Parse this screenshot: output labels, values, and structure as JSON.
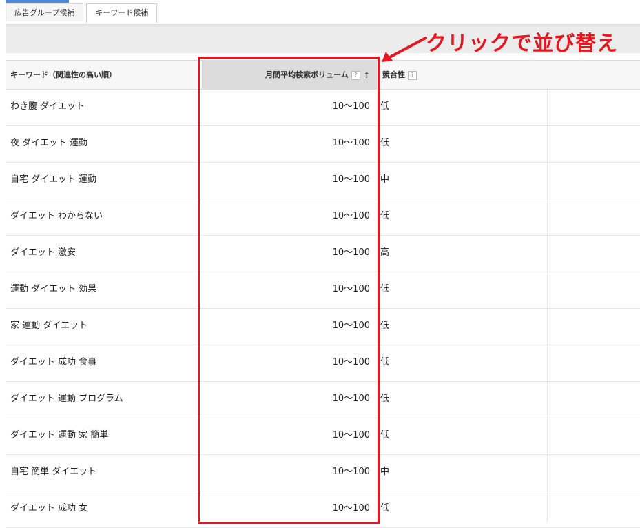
{
  "tabs": [
    {
      "label": "広告グループ候補",
      "active": false
    },
    {
      "label": "キーワード候補",
      "active": true
    }
  ],
  "table": {
    "headers": {
      "keyword": "キーワード（関連性の高い順）",
      "volume": "月間平均検索ボリューム",
      "competition": "競合性",
      "help_glyph": "?",
      "sort_glyph": "↑"
    },
    "rows": [
      {
        "keyword": "わき腹 ダイエット",
        "volume": "10～100",
        "competition": "低"
      },
      {
        "keyword": "夜 ダイエット 運動",
        "volume": "10～100",
        "competition": "低"
      },
      {
        "keyword": "自宅 ダイエット 運動",
        "volume": "10～100",
        "competition": "中"
      },
      {
        "keyword": "ダイエット わからない",
        "volume": "10～100",
        "competition": "低"
      },
      {
        "keyword": "ダイエット 激安",
        "volume": "10～100",
        "competition": "高"
      },
      {
        "keyword": "運動 ダイエット 効果",
        "volume": "10～100",
        "competition": "低"
      },
      {
        "keyword": "家 運動 ダイエット",
        "volume": "10～100",
        "competition": "低"
      },
      {
        "keyword": "ダイエット 成功 食事",
        "volume": "10～100",
        "competition": "低"
      },
      {
        "keyword": "ダイエット 運動 プログラム",
        "volume": "10～100",
        "competition": "低"
      },
      {
        "keyword": "ダイエット 運動 家 簡単",
        "volume": "10～100",
        "competition": "低"
      },
      {
        "keyword": "自宅 簡単 ダイエット",
        "volume": "10～100",
        "competition": "中"
      },
      {
        "keyword": "ダイエット 成功 女",
        "volume": "10～100",
        "competition": "低"
      }
    ]
  },
  "annotation": {
    "text": "クリックで並び替え",
    "color": "#e8141e"
  },
  "colors": {
    "accent": "#4a8ae0",
    "header_sorted_bg": "#dcdcdc",
    "highlight": "#e8141e"
  }
}
